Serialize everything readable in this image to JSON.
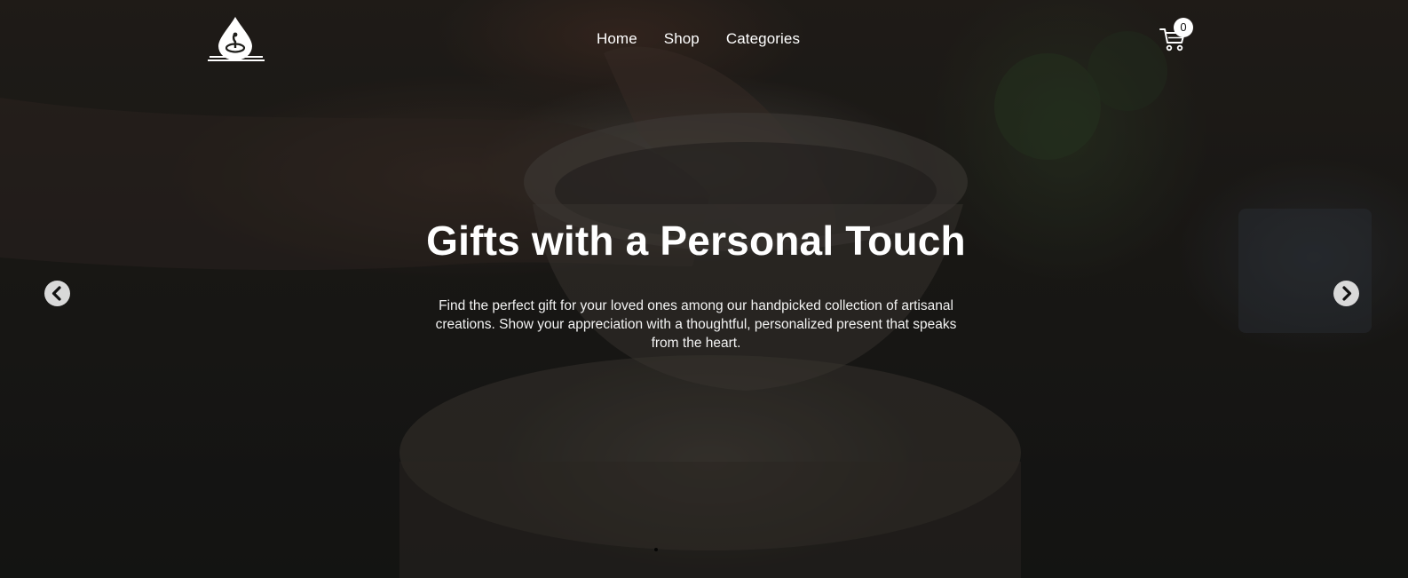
{
  "nav": {
    "items": [
      {
        "label": "Home"
      },
      {
        "label": "Shop"
      },
      {
        "label": "Categories"
      }
    ]
  },
  "cart": {
    "count": "0"
  },
  "hero": {
    "title": "Gifts with a Personal Touch",
    "description": "Find the perfect gift for your loved ones among our handpicked collection of artisanal creations. Show your appreciation with a thoughtful, personalized present that speaks from the heart."
  },
  "carousel": {
    "prev_icon": "chevron-left-icon",
    "next_icon": "chevron-right-icon"
  },
  "colors": {
    "text": "#ffffff",
    "overlay": "#1e1e1b",
    "arrow_bg": "#d9d9d9"
  }
}
